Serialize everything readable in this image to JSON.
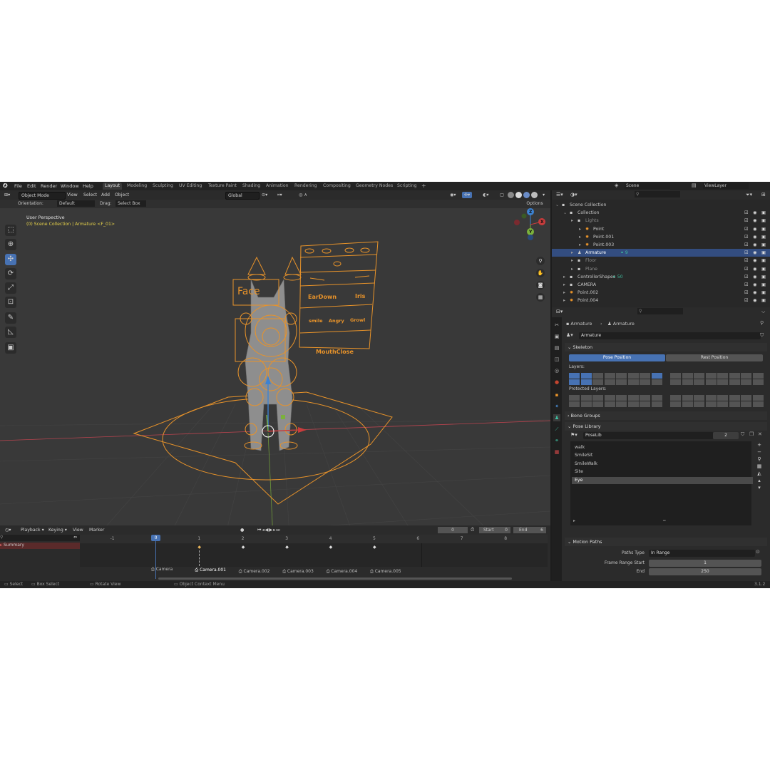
{
  "menu": [
    "File",
    "Edit",
    "Render",
    "Window",
    "Help"
  ],
  "workspaces": [
    "Layout",
    "Modeling",
    "Sculpting",
    "UV Editing",
    "Texture Paint",
    "Shading",
    "Animation",
    "Rendering",
    "Compositing",
    "Geometry Nodes",
    "Scripting",
    "+"
  ],
  "scene": {
    "label": "Scene",
    "viewlayer": "ViewLayer"
  },
  "viewport": {
    "mode": "Object Mode",
    "menus": [
      "View",
      "Select",
      "Add",
      "Object"
    ],
    "transform": "Global",
    "orientation_label": "Orientation:",
    "orientation_value": "Default",
    "drag_label": "Drag:",
    "drag_value": "Select Box",
    "options": "Options",
    "view_name": "User Perspective",
    "context": "(0) Scene Collection | Armature <F_01>",
    "rig_labels": {
      "eardown": "EarDown",
      "iris": "Iris",
      "smile": "smile",
      "angry": "Angry",
      "growl": "Growl",
      "mouthclose": "MouthClose",
      "face": "Face"
    },
    "gizmo": {
      "x": "X",
      "y": "Y",
      "z": "Z"
    }
  },
  "outliner": {
    "rows": [
      {
        "label": "Scene Collection",
        "indent": 0
      },
      {
        "label": "Collection",
        "indent": 1
      },
      {
        "label": "Lights",
        "indent": 2
      },
      {
        "label": "Point",
        "indent": 3
      },
      {
        "label": "Point.001",
        "indent": 3
      },
      {
        "label": "Point.003",
        "indent": 3
      },
      {
        "label": "Armature",
        "indent": 2,
        "selected": true,
        "badge": "9"
      },
      {
        "label": "Floor",
        "indent": 2
      },
      {
        "label": "Plane",
        "indent": 2
      },
      {
        "label": "ControllerShapes",
        "indent": 1,
        "badge": "50"
      },
      {
        "label": "CAMERA",
        "indent": 1
      },
      {
        "label": "Point.002",
        "indent": 1
      },
      {
        "label": "Point.004",
        "indent": 1
      }
    ]
  },
  "properties": {
    "breadcrumb": [
      "Armature",
      "Armature"
    ],
    "data_name": "Armature",
    "skeleton": "Skeleton",
    "pose_position": "Pose Position",
    "rest_position": "Rest Position",
    "layers_label": "Layers:",
    "protected_layers_label": "Protected Layers:",
    "bone_groups": "Bone Groups",
    "pose_library": "Pose Library",
    "poselib_name": "PoseLib",
    "poselib_users": "2",
    "poses": [
      "walk",
      "SmileSit",
      "SmileWalk",
      "Site",
      "Eye"
    ],
    "active_pose": "Eye",
    "motion_paths": "Motion Paths",
    "paths_type_label": "Paths Type",
    "paths_type_value": "In Range",
    "frame_range_start_label": "Frame Range Start",
    "frame_range_start_value": "1",
    "frame_range_end_label": "End",
    "frame_range_end_value": "250"
  },
  "timeline": {
    "menus": [
      "Playback",
      "Keying",
      "View",
      "Marker"
    ],
    "current_frame": "0",
    "start_label": "Start",
    "start_value": "0",
    "end_label": "End",
    "end_value": "6",
    "summary": "Summary",
    "ticks": [
      "-1",
      "0",
      "1",
      "2",
      "3",
      "4",
      "5",
      "6",
      "7",
      "8"
    ],
    "markers": [
      "Camera",
      "Camera.001",
      "Camera.002",
      "Camera.003",
      "Camera.004",
      "Camera.005"
    ]
  },
  "status": {
    "select": "Select",
    "box_select": "Box Select",
    "rotate": "Rotate View",
    "context_menu": "Object Context Menu",
    "version": "3.1.2"
  },
  "colors": {
    "accent": "#4772b3",
    "rig": "#e8932a",
    "selected_row": "#334d80",
    "x_axis": "#c83c3c",
    "y_axis": "#7bb13c",
    "z_axis": "#3c82d2"
  }
}
